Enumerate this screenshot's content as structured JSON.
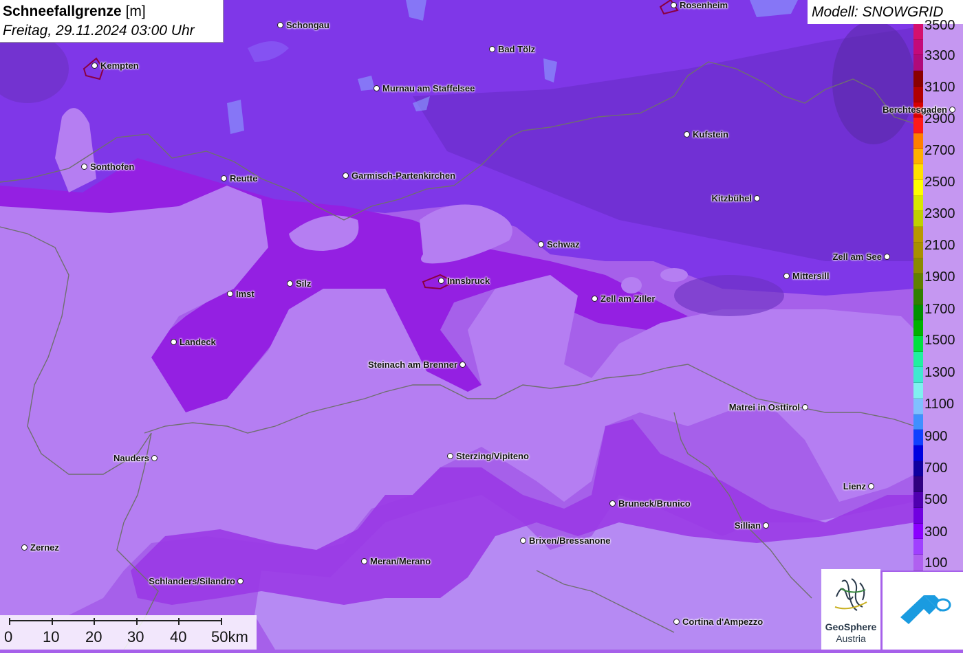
{
  "title": {
    "main": "Schneefallgrenze",
    "unit": "[m]",
    "datetime": "Freitag, 29.11.2024 03:00 Uhr"
  },
  "model_label": "Modell: SNOWGRID",
  "legend": {
    "labels": [
      "3500",
      "3300",
      "3100",
      "2900",
      "2700",
      "2500",
      "2300",
      "2100",
      "1900",
      "1700",
      "1500",
      "1300",
      "1100",
      "900",
      "700",
      "500",
      "300",
      "100"
    ],
    "colors": [
      "#d4106e",
      "#c40a7a",
      "#b00a7a",
      "#8a0000",
      "#b00000",
      "#d80000",
      "#ff1a1a",
      "#ff7f00",
      "#ffb000",
      "#ffe000",
      "#ffff00",
      "#d8e800",
      "#c0d000",
      "#b89800",
      "#a89000",
      "#8a8a00",
      "#608000",
      "#2f7f00",
      "#009000",
      "#00b000",
      "#00e040",
      "#20f0a0",
      "#40e8d0",
      "#80f0f0",
      "#80c0ff",
      "#4090ff",
      "#1040ff",
      "#0000e0",
      "#1000a0",
      "#300080",
      "#5000b0",
      "#7000e0",
      "#8a00ff",
      "#a040ff",
      "#b060f0"
    ]
  },
  "cities": [
    {
      "name": "Rosenheim",
      "side": "right"
    },
    {
      "name": "Schongau",
      "side": "right"
    },
    {
      "name": "Kempten",
      "side": "right"
    },
    {
      "name": "Bad Tölz",
      "side": "right"
    },
    {
      "name": "Murnau am Staffelsee",
      "side": "right"
    },
    {
      "name": "Berchtesgaden",
      "side": "left"
    },
    {
      "name": "Kufstein",
      "side": "right"
    },
    {
      "name": "Sonthofen",
      "side": "right"
    },
    {
      "name": "Reutte",
      "side": "right"
    },
    {
      "name": "Garmisch-Partenkirchen",
      "side": "right"
    },
    {
      "name": "Kitzbühel",
      "side": "left"
    },
    {
      "name": "Schwaz",
      "side": "right"
    },
    {
      "name": "Zell am See",
      "side": "left"
    },
    {
      "name": "Mittersill",
      "side": "right"
    },
    {
      "name": "Silz",
      "side": "right"
    },
    {
      "name": "Innsbruck",
      "side": "right"
    },
    {
      "name": "Imst",
      "side": "right"
    },
    {
      "name": "Zell am Ziller",
      "side": "right"
    },
    {
      "name": "Landeck",
      "side": "right"
    },
    {
      "name": "Steinach am Brenner",
      "side": "left"
    },
    {
      "name": "Matrei in Osttirol",
      "side": "left"
    },
    {
      "name": "Nauders",
      "side": "left"
    },
    {
      "name": "Sterzing/Vipiteno",
      "side": "right"
    },
    {
      "name": "Lienz",
      "side": "left"
    },
    {
      "name": "Bruneck/Brunico",
      "side": "right"
    },
    {
      "name": "Sillian",
      "side": "left"
    },
    {
      "name": "Brixen/Bressanone",
      "side": "right"
    },
    {
      "name": "Zernez",
      "side": "right"
    },
    {
      "name": "Meran/Merano",
      "side": "right"
    },
    {
      "name": "Schlanders/Silandro",
      "side": "left"
    },
    {
      "name": "Cortina d'Ampezzo",
      "side": "right"
    }
  ],
  "scale": {
    "labels": [
      "0",
      "10",
      "20",
      "30",
      "40",
      "50km"
    ]
  },
  "logos": {
    "geosphere_line1": "GeoSphere",
    "geosphere_line2": "Austria"
  },
  "colors": {
    "low_snowline": "#b07ef0",
    "mid_snowline": "#8a3af5",
    "dark_snowline": "#7a2ee0",
    "valley_band": "#9a20e0",
    "border": "#777777"
  }
}
